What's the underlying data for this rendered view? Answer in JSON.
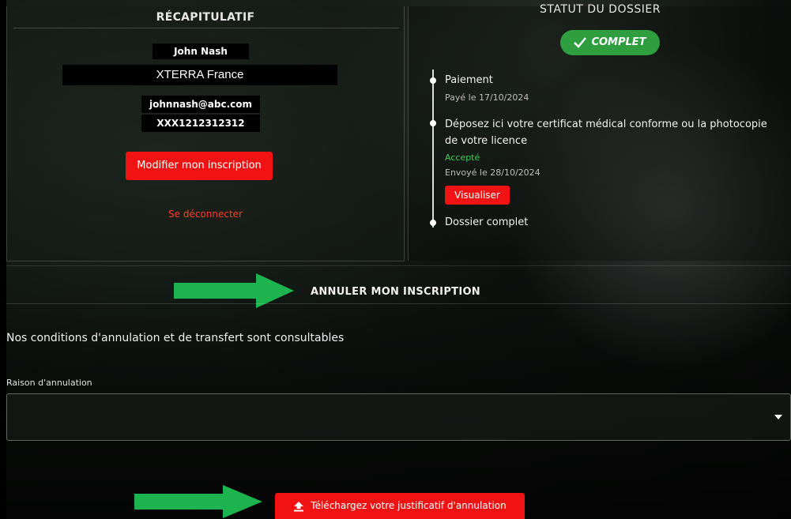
{
  "recap": {
    "title": "RÉCAPITULATIF",
    "name": "John Nash",
    "company": "XTERRA France",
    "email": "johnnash@abc.com",
    "code": "XXX1212312312",
    "modify_button": "Modifier mon inscription",
    "logout_link": "Se déconnecter"
  },
  "status": {
    "title": "STATUT DU DOSSIER",
    "badge": "COMPLET",
    "steps": [
      {
        "label": "Paiement",
        "sub": "Payé le 17/10/2024"
      },
      {
        "label_line1": "Déposez ici votre certificat médical conforme ou la photocopie",
        "label_line2": "de votre licence",
        "state": "Accepté",
        "sub": "Envoyé le 28/10/2024",
        "button": "Visualiser"
      },
      {
        "label": "Dossier complet"
      }
    ]
  },
  "cancel": {
    "title": "ANNULER MON INSCRIPTION",
    "conditions_text": "Nos conditions d'annulation et de transfert sont consultables",
    "reason_label": "Raison d'annulation",
    "reason_value": "",
    "upload_button": "Téléchargez votre justificatif d'annulation"
  },
  "colors": {
    "accent_red": "#f11313",
    "success_green": "#2f9e3f",
    "arrow_green": "#1db34f"
  },
  "icons": [
    "check-icon",
    "upload-icon",
    "chevron-down-icon",
    "arrow-right-icon"
  ]
}
